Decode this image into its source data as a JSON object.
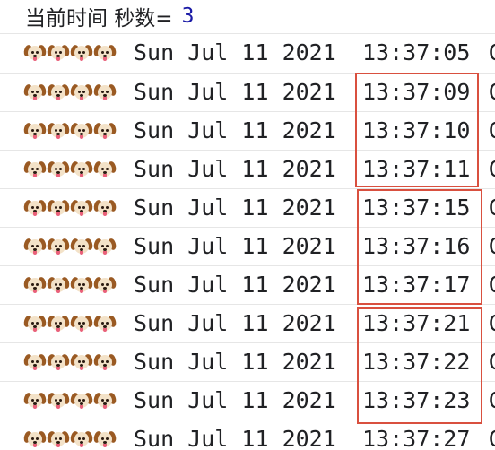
{
  "header": {
    "label": "当前时间 秒数=",
    "value": "3"
  },
  "rows": [
    {
      "dogs": "🐶🐶🐶🐶",
      "date": "Sun Jul 11 2021",
      "time": "13:37:05",
      "overflow": "G"
    },
    {
      "dogs": "🐶🐶🐶🐶",
      "date": "Sun Jul 11 2021",
      "time": "13:37:09",
      "overflow": "G"
    },
    {
      "dogs": "🐶🐶🐶🐶",
      "date": "Sun Jul 11 2021",
      "time": "13:37:10",
      "overflow": "G"
    },
    {
      "dogs": "🐶🐶🐶🐶",
      "date": "Sun Jul 11 2021",
      "time": "13:37:11",
      "overflow": "G"
    },
    {
      "dogs": "🐶🐶🐶🐶",
      "date": "Sun Jul 11 2021",
      "time": "13:37:15",
      "overflow": "G"
    },
    {
      "dogs": "🐶🐶🐶🐶",
      "date": "Sun Jul 11 2021",
      "time": "13:37:16",
      "overflow": "G"
    },
    {
      "dogs": "🐶🐶🐶🐶",
      "date": "Sun Jul 11 2021",
      "time": "13:37:17",
      "overflow": "G"
    },
    {
      "dogs": "🐶🐶🐶🐶",
      "date": "Sun Jul 11 2021",
      "time": "13:37:21",
      "overflow": "G"
    },
    {
      "dogs": "🐶🐶🐶🐶",
      "date": "Sun Jul 11 2021",
      "time": "13:37:22",
      "overflow": "G"
    },
    {
      "dogs": "🐶🐶🐶🐶",
      "date": "Sun Jul 11 2021",
      "time": "13:37:23",
      "overflow": "G"
    },
    {
      "dogs": "🐶🐶🐶🐶",
      "date": "Sun Jul 11 2021",
      "time": "13:37:27",
      "overflow": "G"
    }
  ],
  "colors": {
    "value": "#1a1aa6",
    "highlight_border": "#d9503f",
    "row_divider": "#e6e6e6"
  }
}
